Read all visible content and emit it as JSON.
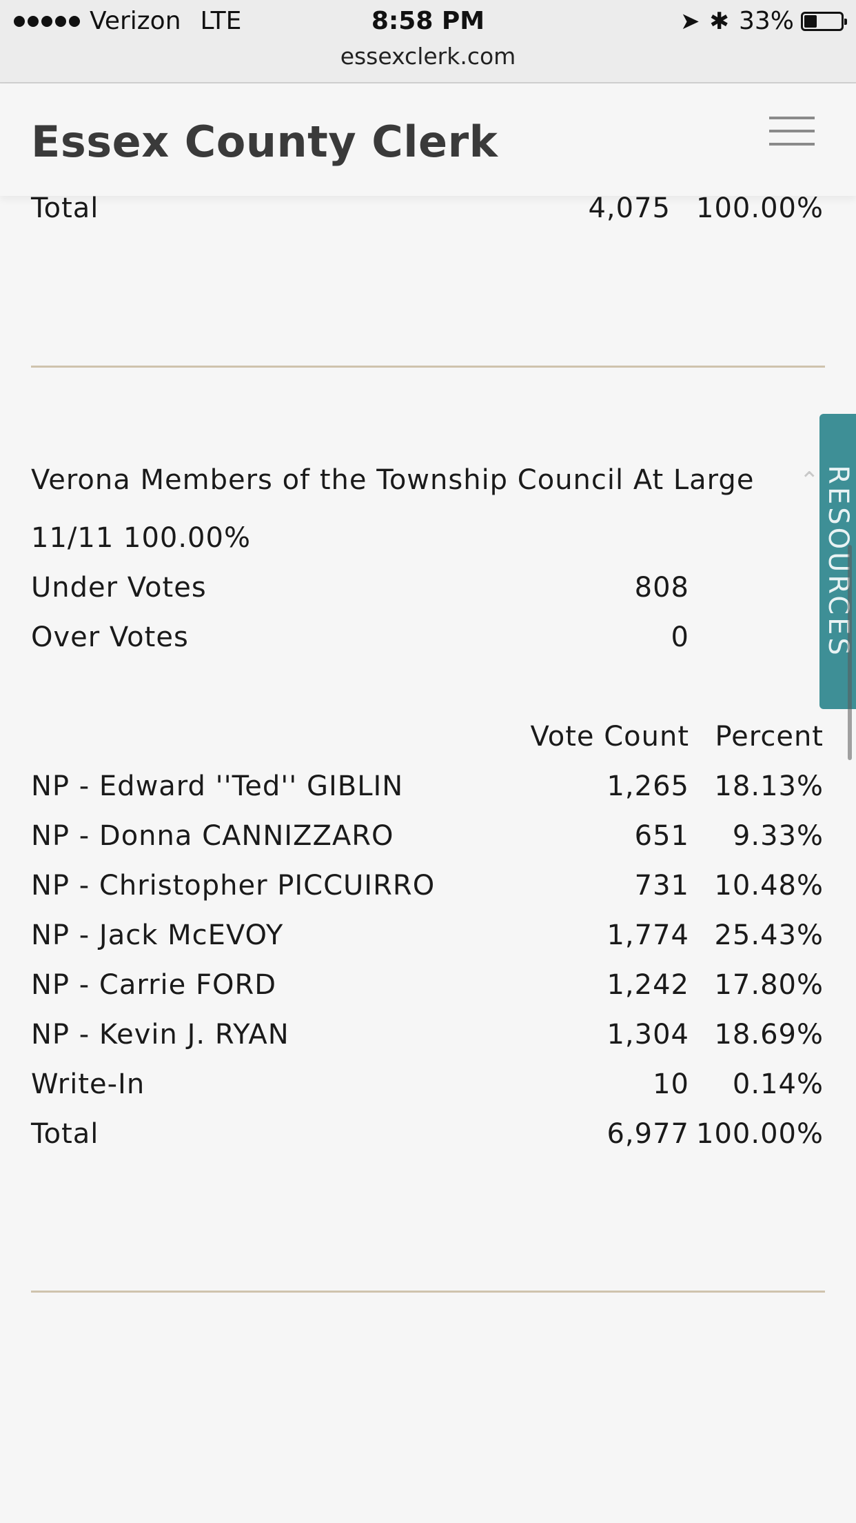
{
  "status_bar": {
    "carrier": "Verizon",
    "network": "LTE",
    "time": "8:58 PM",
    "battery": "33%",
    "battery_level": 0.33,
    "url": "essexclerk.com"
  },
  "header": {
    "title": "Essex County Clerk"
  },
  "previous_race": {
    "total_label": "Total",
    "total_count": "4,075",
    "total_percent": "100.00%"
  },
  "race": {
    "title": "Verona Members of the Township Council At Large",
    "reporting": "11/11 100.00%",
    "under_votes_label": "Under Votes",
    "under_votes": "808",
    "over_votes_label": "Over Votes",
    "over_votes": "0",
    "col_vote_count": "Vote Count",
    "col_percent": "Percent",
    "candidates": [
      {
        "name": "NP - Edward ''Ted'' GIBLIN",
        "count": "1,265",
        "percent": "18.13%"
      },
      {
        "name": "NP - Donna CANNIZZARO",
        "count": "651",
        "percent": "9.33%"
      },
      {
        "name": "NP - Christopher PICCUIRRO",
        "count": "731",
        "percent": "10.48%"
      },
      {
        "name": "NP - Jack McEVOY",
        "count": "1,774",
        "percent": "25.43%"
      },
      {
        "name": "NP - Carrie FORD",
        "count": "1,242",
        "percent": "17.80%"
      },
      {
        "name": "NP - Kevin J. RYAN",
        "count": "1,304",
        "percent": "18.69%"
      },
      {
        "name": "Write-In",
        "count": "10",
        "percent": "0.14%"
      }
    ],
    "total_label": "Total",
    "total_count": "6,977",
    "total_percent": "100.00%"
  },
  "resources_tab": {
    "label": "RESOURCES"
  }
}
